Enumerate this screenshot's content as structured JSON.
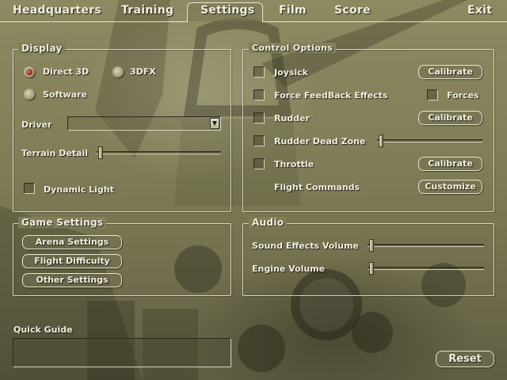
{
  "menu": {
    "headquarters": "Headquarters",
    "training": "Training",
    "settings": "Settings",
    "film": "Film",
    "score": "Score",
    "exit": "Exit",
    "active": "Settings"
  },
  "display": {
    "title": "Display",
    "direct3d": "Direct 3D",
    "threedfx": "3DFX",
    "software": "Software",
    "selected_renderer": "Direct 3D",
    "driver_label": "Driver",
    "driver_value": "",
    "terrain_label": "Terrain Detail",
    "terrain_level": 0.0,
    "dynamic_light_label": "Dynamic Light",
    "dynamic_light_checked": false
  },
  "control": {
    "title": "Control Options",
    "joysick": "Joysick",
    "force_feedback": "Force FeedBack Effects",
    "forces": "Forces",
    "rudder": "Rudder",
    "rudder_dead_zone": "Rudder Dead Zone",
    "rudder_dead_zone_level": 0.0,
    "throttle": "Throttle",
    "flight_commands": "Flight Commands",
    "calibrate": "Calibrate",
    "customize": "Customize"
  },
  "game": {
    "title": "Game Settings",
    "arena": "Arena Settings",
    "difficulty": "Flight Difficulty",
    "other": "Other Settings"
  },
  "audio": {
    "title": "Audio",
    "sound_effects": "Sound Effects Volume",
    "sound_effects_level": 0.0,
    "engine": "Engine Volume",
    "engine_level": 0.0
  },
  "quick_guide": {
    "title": "Quick Guide",
    "text": ""
  },
  "reset": "Reset",
  "colors": {
    "background": "#817f59",
    "text": "#f1eede",
    "border": "#dcd9c2",
    "radio_selected": "#8b1d18"
  }
}
